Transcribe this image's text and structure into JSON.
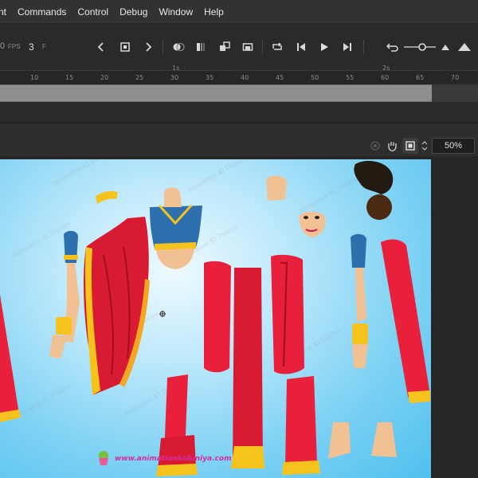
{
  "menu": [
    "nt",
    "Commands",
    "Control",
    "Debug",
    "Window",
    "Help"
  ],
  "timeline": {
    "fps_value": "0",
    "fps_unit": "FPS",
    "current_frame": "3",
    "frame_unit": "F",
    "ruler_ticks": [
      "10",
      "15",
      "20",
      "25",
      "30",
      "35",
      "40",
      "45",
      "50",
      "55",
      "60",
      "65",
      "70"
    ],
    "second_marks": [
      "1s",
      "2s"
    ]
  },
  "stage_toolbar": {
    "zoom": "50%"
  },
  "stage": {
    "watermark": "Animation Ki Duniya",
    "site_url": "www.animationkiduniya.com"
  },
  "colors": {
    "menubar": "#323232",
    "panel": "#2a2a2a",
    "stage_center": "#eefaff",
    "stage_edge": "#4fc0ee",
    "saree_red": "#e8203c",
    "gold": "#f6c31d",
    "blouse_blue": "#2e6fae",
    "skin": "#f2c193"
  },
  "icons": [
    "undo-icon",
    "zoom-slider",
    "mountain-icon",
    "prev-keyframe-icon",
    "center-icon",
    "onion-skin-icon",
    "edit-multiple-icon",
    "loop-icon",
    "step-back-icon",
    "play-icon",
    "step-forward-icon",
    "camera-icon",
    "pin-icon",
    "clip-icon"
  ]
}
